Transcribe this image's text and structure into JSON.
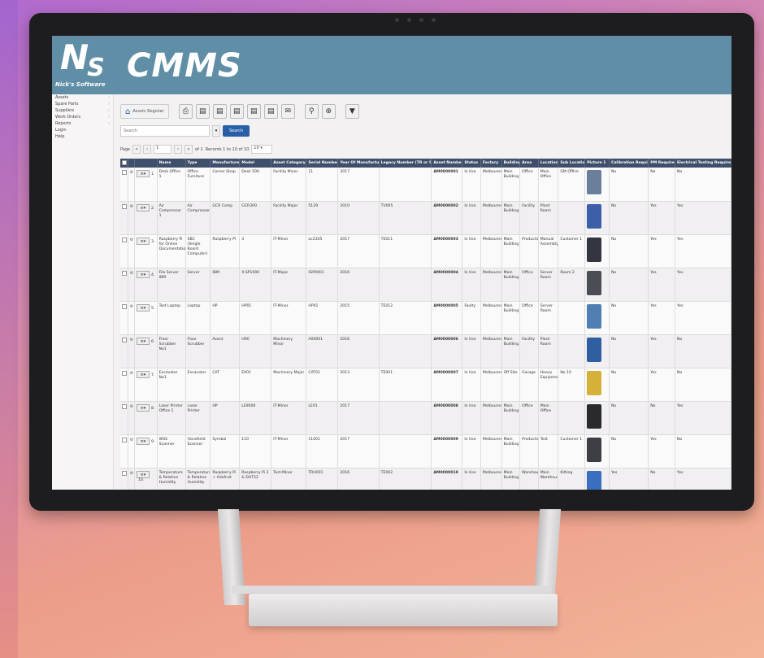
{
  "app": {
    "logo_ns": "N",
    "logo_s": "S",
    "logo_sub": "Nick's Software",
    "logo_cmms": "CMMS"
  },
  "sidebar": {
    "items": [
      {
        "label": "Assets"
      },
      {
        "label": "Spare Parts"
      },
      {
        "label": "Suppliers"
      },
      {
        "label": "Work Orders"
      },
      {
        "label": "Reports"
      },
      {
        "label": "Login"
      },
      {
        "label": "Help"
      }
    ]
  },
  "toolbar": {
    "breadcrumb": "Assets Register",
    "icons": [
      "printer-icon",
      "document-icon",
      "document-icon",
      "document-icon",
      "document-icon",
      "document-icon",
      "email-icon",
      "zoom-icon",
      "zoom-plus-icon",
      "filter-icon"
    ]
  },
  "search": {
    "placeholder": "Search",
    "button": "Search"
  },
  "pager": {
    "page_label": "Page",
    "page_value": "1",
    "of_label": "of 1",
    "records": "Records 1 to 10 of 10",
    "page_size": "10"
  },
  "grid": {
    "columns": [
      "",
      "",
      "",
      "Name",
      "Type",
      "Manufacturer",
      "Model",
      "Asset Category",
      "Serial Number",
      "Year Of Manufacture",
      "Legacy Number (TR or SQ)",
      "Asset Number",
      "Status",
      "Factory",
      "Building",
      "Area",
      "Location",
      "Sub Location",
      "Picture 1",
      "Calibration Required",
      "PM Required",
      "Electrical Testing Required"
    ],
    "rows": [
      {
        "n": "1.",
        "name": "Desk Office 1",
        "type": "Office Furniture",
        "mfr": "Corner Shop",
        "model": "Desk 500",
        "cat": "Facility Minor",
        "serial": "11",
        "year": "2017",
        "legacy": "",
        "asset": "AM0000001",
        "status": "In Use",
        "factory": "Melbourne",
        "building": "Main Building",
        "area": "Office",
        "loc": "Main Office",
        "subloc": "GM Office",
        "pic": "#6b7f9a",
        "calib": "No",
        "pm": "No",
        "elec": "No"
      },
      {
        "n": "2.",
        "name": "Air Compressor 1",
        "type": "Air Compressor",
        "mfr": "GCR Comp",
        "model": "GCR300",
        "cat": "Facility Major",
        "serial": "5129",
        "year": "2010",
        "legacy": "TV005",
        "asset": "AM0000002",
        "status": "In Use",
        "factory": "Melbourne",
        "building": "Main Building",
        "area": "Facility",
        "loc": "Plant Room",
        "subloc": "",
        "pic": "#3d5fa8",
        "calib": "No",
        "pm": "Yes",
        "elec": "Yes"
      },
      {
        "n": "3.",
        "name": "Raspberry Pi for Online Documentation",
        "type": "SBC (Single Board Computer)",
        "mfr": "Raspberry Pi",
        "model": "3",
        "cat": "IT-Minor",
        "serial": "ac2345",
        "year": "2017",
        "legacy": "TE011",
        "asset": "AM0000003",
        "status": "In Use",
        "factory": "Melbourne",
        "building": "Main Building",
        "area": "Production",
        "loc": "Manual Assembly",
        "subloc": "Customer 1",
        "pic": "#333640",
        "calib": "No",
        "pm": "Yes",
        "elec": "Yes"
      },
      {
        "n": "4.",
        "name": "File Server IBM",
        "type": "Server",
        "mfr": "IBM",
        "model": "X-SP1000",
        "cat": "IT-Major",
        "serial": "IGP0001",
        "year": "2016",
        "legacy": "",
        "asset": "AM0000004",
        "status": "In Use",
        "factory": "Melbourne",
        "building": "Main Building",
        "area": "Office",
        "loc": "Server Room",
        "subloc": "Room 2",
        "pic": "#4b4d55",
        "calib": "No",
        "pm": "Yes",
        "elec": "Yes"
      },
      {
        "n": "5.",
        "name": "Test Laptop",
        "type": "Laptop",
        "mfr": "HP",
        "model": "HP01",
        "cat": "IT-Minor",
        "serial": "HP01",
        "year": "2015",
        "legacy": "TE012",
        "asset": "AM0000005",
        "status": "Faulty",
        "factory": "Melbourne",
        "building": "Main Building",
        "area": "Office",
        "loc": "Server Room",
        "subloc": "",
        "pic": "#4f7fb3",
        "calib": "No",
        "pm": "Yes",
        "elec": "Yes"
      },
      {
        "n": "6.",
        "name": "Floor Scrubber No1",
        "type": "Floor Scrubber",
        "mfr": "Avant",
        "model": "HR0",
        "cat": "Machinery Minor",
        "serial": "A00001",
        "year": "2016",
        "legacy": "",
        "asset": "AM0000006",
        "status": "In Use",
        "factory": "Melbourne",
        "building": "Main Building",
        "area": "Facility",
        "loc": "Plant Room",
        "subloc": "",
        "pic": "#2f5fa0",
        "calib": "No",
        "pm": "Yes",
        "elec": "No"
      },
      {
        "n": "7.",
        "name": "Excavator No1",
        "type": "Excavator",
        "mfr": "CAT",
        "model": "E001",
        "cat": "Machinery Major",
        "serial": "CAT01",
        "year": "2013",
        "legacy": "TE001",
        "asset": "AM0000007",
        "status": "In Use",
        "factory": "Melbourne",
        "building": "Off Site",
        "area": "Garage",
        "loc": "Heavy Equipment",
        "subloc": "No 10",
        "pic": "#d6b13a",
        "calib": "No",
        "pm": "Yes",
        "elec": "No"
      },
      {
        "n": "8.",
        "name": "Laser Printer Office 1",
        "type": "Laser Printer",
        "mfr": "HP",
        "model": "LE9000",
        "cat": "IT-Minor",
        "serial": "LE01",
        "year": "2017",
        "legacy": "",
        "asset": "AM0000008",
        "status": "In Use",
        "factory": "Melbourne",
        "building": "Main Building",
        "area": "Office",
        "loc": "Main Office",
        "subloc": "",
        "pic": "#2a2a2e",
        "calib": "No",
        "pm": "No",
        "elec": "Yes"
      },
      {
        "n": "9.",
        "name": "WSS Scanner",
        "type": "Handheld Scanner",
        "mfr": "Symbol",
        "model": "110",
        "cat": "IT-Minor",
        "serial": "11001",
        "year": "2017",
        "legacy": "",
        "asset": "AM0000009",
        "status": "In Use",
        "factory": "Melbourne",
        "building": "Main Building",
        "area": "Production",
        "loc": "Test",
        "subloc": "Customer 1",
        "pic": "#3d3f45",
        "calib": "No",
        "pm": "Yes",
        "elec": "No"
      },
      {
        "n": "10.",
        "name": "Temperature & Relative Humidity",
        "type": "Temperature & Relative Humidity",
        "mfr": "Raspberry Pi + Adafruit",
        "model": "Raspberry Pi 3 & DHT22",
        "cat": "Test-Minor",
        "serial": "TRH001",
        "year": "2016",
        "legacy": "TE002",
        "asset": "AM0000010",
        "status": "In Use",
        "factory": "Melbourne",
        "building": "Main Building",
        "area": "Warehouse",
        "loc": "Main Warehouse",
        "subloc": "Kitting",
        "pic": "#3a6fc0",
        "calib": "Yes",
        "pm": "No",
        "elec": "Yes"
      }
    ]
  }
}
